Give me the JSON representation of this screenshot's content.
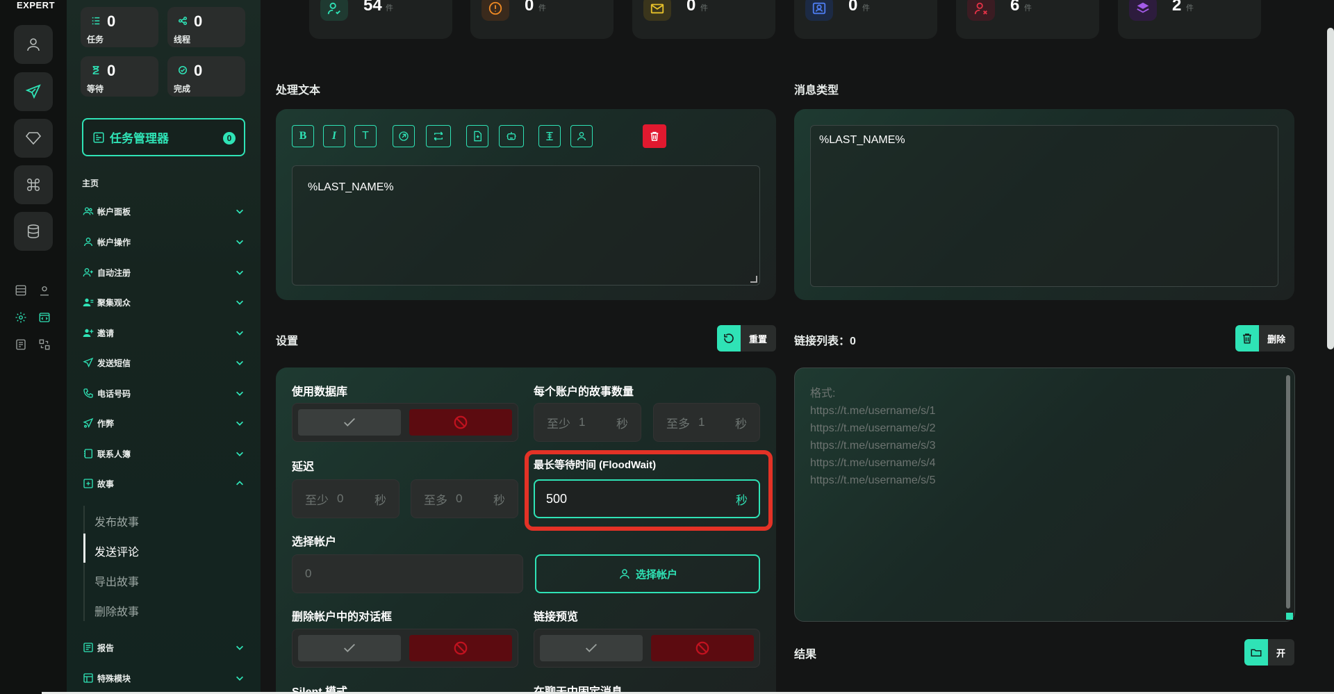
{
  "brand": "EXPERT",
  "rail": {
    "buttons": [
      "user-icon",
      "send-icon",
      "diamond-icon",
      "command-icon",
      "database-icon"
    ],
    "mini_icons": [
      "stack-icon",
      "map-pin-icon",
      "gear-icon",
      "code-window-icon",
      "checklist-icon",
      "sitemap-icon"
    ]
  },
  "sidebar": {
    "stats": [
      {
        "value": "0",
        "label": "任务"
      },
      {
        "value": "0",
        "label": "线程"
      },
      {
        "value": "0",
        "label": "等待"
      },
      {
        "value": "0",
        "label": "完成"
      }
    ],
    "task_manager": {
      "label": "任务管理器",
      "badge": "0"
    },
    "section_head": "主页",
    "nav": [
      {
        "label": "帐户面板",
        "icon": "users-icon"
      },
      {
        "label": "帐户操作",
        "icon": "user-icon"
      },
      {
        "label": "自动注册",
        "icon": "user-plus-icon"
      },
      {
        "label": "聚集观众",
        "icon": "user-group-icon"
      },
      {
        "label": "邀请",
        "icon": "user-add-icon"
      },
      {
        "label": "发送短信",
        "icon": "send-icon"
      },
      {
        "label": "电话号码",
        "icon": "phone-icon"
      },
      {
        "label": "作弊",
        "icon": "send-star-icon"
      },
      {
        "label": "联系人簿",
        "icon": "contact-book-icon"
      },
      {
        "label": "故事",
        "icon": "plus-square-icon"
      }
    ],
    "story_sub": [
      "发布故事",
      "发送评论",
      "导出故事",
      "删除故事"
    ],
    "nav_bottom": [
      {
        "label": "报告",
        "icon": "report-icon"
      },
      {
        "label": "特殊模块",
        "icon": "module-icon"
      }
    ]
  },
  "top_stats": [
    {
      "value": "54",
      "unit": "件",
      "color": "#2fe3b6"
    },
    {
      "value": "0",
      "unit": "件",
      "color": "#f08a24"
    },
    {
      "value": "0",
      "unit": "件",
      "color": "#e8c22a"
    },
    {
      "value": "0",
      "unit": "件",
      "color": "#4d7cf0"
    },
    {
      "value": "6",
      "unit": "件",
      "color": "#e33246"
    },
    {
      "value": "2",
      "unit": "件",
      "color": "#a35be8"
    }
  ],
  "process_text": {
    "title": "处理文本",
    "toolbar": [
      "B",
      "I",
      "T"
    ],
    "content": "%LAST_NAME%"
  },
  "message_type": {
    "title": "消息类型",
    "content": "%LAST_NAME%"
  },
  "settings": {
    "title": "设置",
    "reset_label": "重置",
    "use_db_label": "使用数据库",
    "stories_per_account_label": "每个账户的故事数量",
    "stories_min": {
      "prefix": "至少",
      "value": "1",
      "unit": "秒"
    },
    "stories_max": {
      "prefix": "至多",
      "value": "1",
      "unit": "秒"
    },
    "delay_label": "延迟",
    "delay_min": {
      "prefix": "至少",
      "value": "0",
      "unit": "秒"
    },
    "delay_max": {
      "prefix": "至多",
      "value": "0",
      "unit": "秒"
    },
    "floodwait_label": "最长等待时间 (FloodWait)",
    "floodwait_value": "500",
    "floodwait_unit": "秒",
    "select_account_label": "选择帐户",
    "select_account_value": "0",
    "select_account_button": "选择帐户",
    "delete_dialog_label": "删除帐户中的对话框",
    "link_preview_label": "链接预览",
    "silent_label": "Silent 模式",
    "pin_label": "在聊天中固定消息"
  },
  "links": {
    "title": "链接列表：0",
    "delete_label": "删除",
    "placeholder_lines": [
      "格式:",
      "https://t.me/username/s/1",
      "https://t.me/username/s/2",
      "https://t.me/username/s/3",
      "https://t.me/username/s/4",
      "https://t.me/username/s/5"
    ]
  },
  "results": {
    "title": "结果",
    "open_label": "开"
  }
}
